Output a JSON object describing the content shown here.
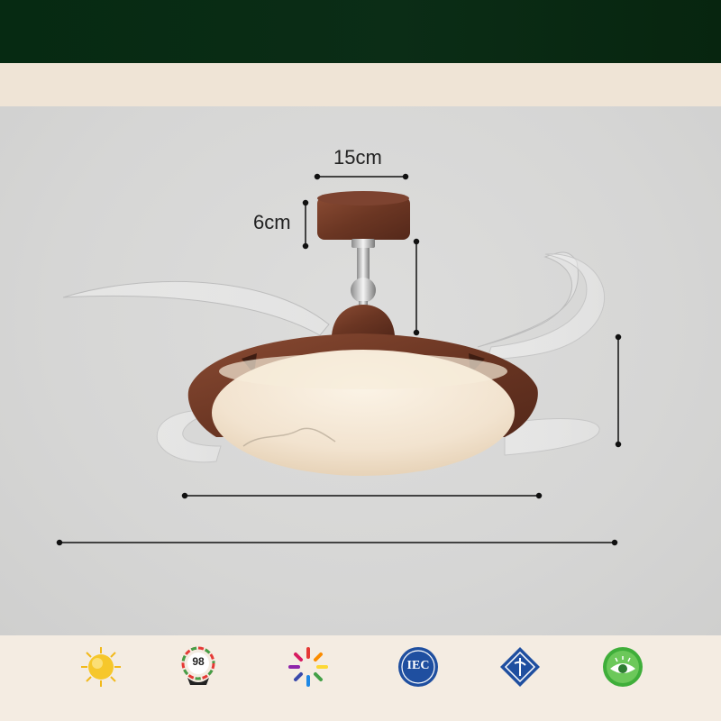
{
  "dimensions": {
    "canopy_width": "15cm",
    "canopy_height": "6cm"
  },
  "colors": {
    "banner": "#062a12",
    "wood": "#6e3a26",
    "accent_green": "#3fae3a"
  },
  "icons": [
    {
      "name": "sun-icon"
    },
    {
      "name": "cri-98-icon",
      "label": "98"
    },
    {
      "name": "color-spectrum-icon"
    },
    {
      "name": "iec-icon",
      "label": "IEC"
    },
    {
      "name": "certification-diamond-icon"
    },
    {
      "name": "eye-care-icon"
    }
  ]
}
